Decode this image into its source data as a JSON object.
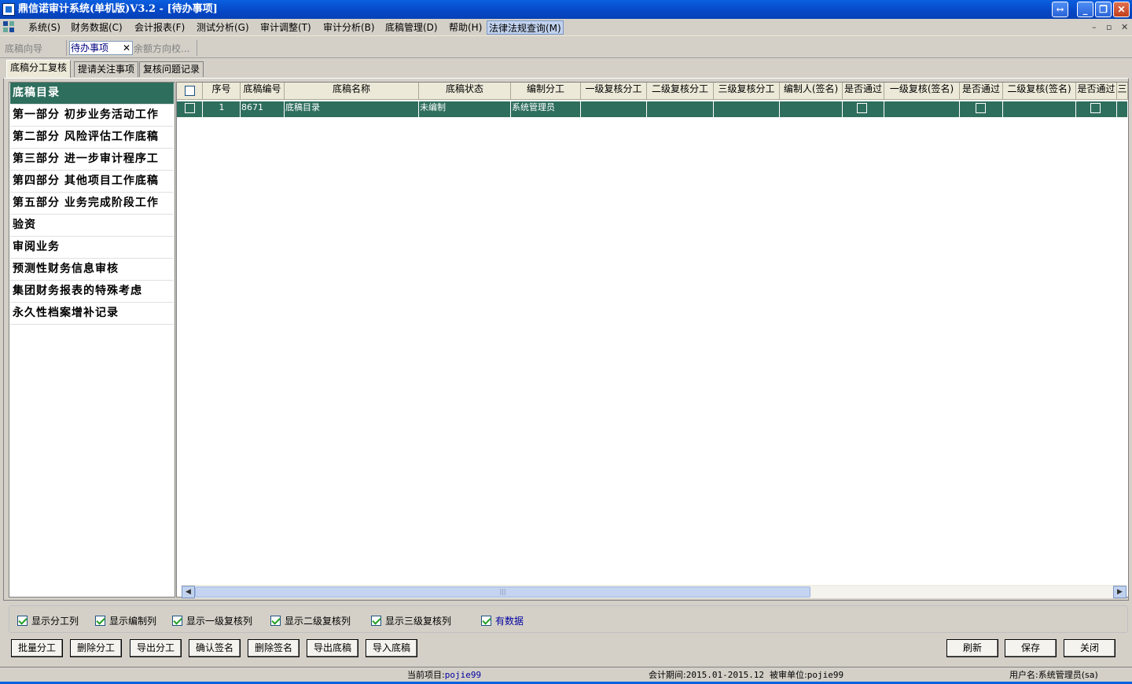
{
  "window": {
    "title": "鼎信诺审计系统(单机版)V3.2 - [待办事项]"
  },
  "menu": {
    "items": [
      "系统(S)",
      "财务数据(C)",
      "会计报表(F)",
      "测试分析(G)",
      "审计调整(T)",
      "审计分析(B)",
      "底稿管理(D)",
      "帮助(H)",
      "法律法规查询(M)"
    ],
    "mdi": [
      "–",
      "▫",
      "✕"
    ]
  },
  "nav": {
    "guide": "底稿向导",
    "active_tab": "待办事项",
    "close": "✕",
    "next": "余额方向校..."
  },
  "tabs": [
    "底稿分工复核",
    "提请关注事项",
    "复核问题记录"
  ],
  "tree": [
    "底稿目录",
    "第一部分 初步业务活动工作",
    "第二部分 风险评估工作底稿",
    "第三部分 进一步审计程序工",
    "第四部分 其他项目工作底稿",
    "第五部分 业务完成阶段工作",
    "验资",
    "审阅业务",
    "预测性财务信息审核",
    "集团财务报表的特殊考虑",
    "永久性档案增补记录"
  ],
  "grid": {
    "columns": [
      "",
      "序号",
      "底稿编号",
      "底稿名称",
      "底稿状态",
      "编制分工",
      "一级复核分工",
      "二级复核分工",
      "三级复核分工",
      "编制人(签名)",
      "是否通过",
      "一级复核(签名)",
      "是否通过",
      "二级复核(签名)",
      "是否通过",
      "三"
    ],
    "rows": [
      {
        "seq": "1",
        "code": "8671",
        "name": "底稿目录",
        "status": "未编制",
        "preparer": "系统管理员"
      }
    ]
  },
  "options": [
    {
      "label": "显示分工列",
      "checked": true
    },
    {
      "label": "显示编制列",
      "checked": true
    },
    {
      "label": "显示一级复核列",
      "checked": true
    },
    {
      "label": "显示二级复核列",
      "checked": true
    },
    {
      "label": "显示三级复核列",
      "checked": true
    },
    {
      "label": "有数据",
      "checked": true
    }
  ],
  "buttons_left": [
    "批量分工",
    "删除分工",
    "导出分工",
    "确认签名",
    "删除签名",
    "导出底稿",
    "导入底稿"
  ],
  "buttons_right": [
    "刷新",
    "保存",
    "关闭"
  ],
  "status": {
    "project_label": "当前项目:",
    "project": "pojie99",
    "period_label": "会计期间:",
    "period": "2015.01-2015.12",
    "unit_label": "被审单位:",
    "unit": "pojie99",
    "user_label": "用户名:",
    "user": "系统管理员(sa)"
  },
  "colors": {
    "title_blue": "#0a5fe0",
    "selected_row": "#2e6e5c",
    "face": "#d4d0c8"
  }
}
